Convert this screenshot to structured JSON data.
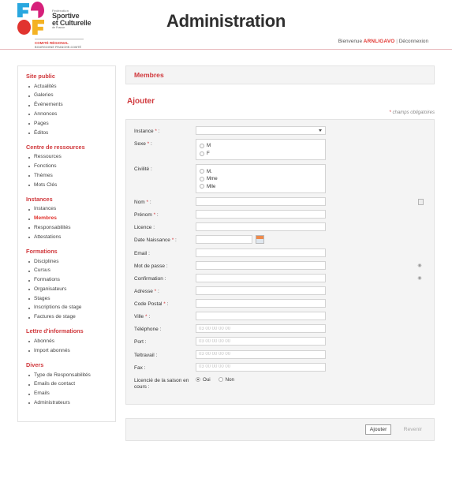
{
  "header": {
    "title": "Administration",
    "logo": {
      "federation": "Fédération",
      "line1": "Sportive",
      "line2": "et Culturelle",
      "line3": "de France",
      "comite": "COMITÉ RÉGIONAL",
      "region": "BOURGOGNE FRANCHE-COMTÉ"
    },
    "welcome_prefix": "Bienvenue",
    "username": "ARNLIGAVO",
    "separator": "|",
    "logout": "Déconnexion",
    "accent_color": "#d0383c"
  },
  "sidebar": {
    "groups": [
      {
        "title": "Site public",
        "items": [
          {
            "label": "Actualités",
            "active": false
          },
          {
            "label": "Galeries",
            "active": false
          },
          {
            "label": "Événements",
            "active": false
          },
          {
            "label": "Annonces",
            "active": false
          },
          {
            "label": "Pages",
            "active": false
          },
          {
            "label": "Éditos",
            "active": false
          }
        ]
      },
      {
        "title": "Centre de ressources",
        "items": [
          {
            "label": "Ressources",
            "active": false
          },
          {
            "label": "Fonctions",
            "active": false
          },
          {
            "label": "Thèmes",
            "active": false
          },
          {
            "label": "Mots Clés",
            "active": false
          }
        ]
      },
      {
        "title": "Instances",
        "items": [
          {
            "label": "Instances",
            "active": false
          },
          {
            "label": "Membres",
            "active": true
          },
          {
            "label": "Responsabilités",
            "active": false
          },
          {
            "label": "Attestations",
            "active": false
          }
        ]
      },
      {
        "title": "Formations",
        "items": [
          {
            "label": "Disciplines",
            "active": false
          },
          {
            "label": "Cursus",
            "active": false
          },
          {
            "label": "Formations",
            "active": false
          },
          {
            "label": "Organisateurs",
            "active": false
          },
          {
            "label": "Stages",
            "active": false
          },
          {
            "label": "Inscriptions de stage",
            "active": false
          },
          {
            "label": "Factures de stage",
            "active": false
          }
        ]
      },
      {
        "title": "Lettre d'informations",
        "items": [
          {
            "label": "Abonnés",
            "active": false
          },
          {
            "label": "Import abonnés",
            "active": false
          }
        ]
      },
      {
        "title": "Divers",
        "items": [
          {
            "label": "Type de Responsabilités",
            "active": false
          },
          {
            "label": "Emails de contact",
            "active": false
          },
          {
            "label": "Emails",
            "active": false
          },
          {
            "label": "Administrateurs",
            "active": false
          }
        ]
      }
    ]
  },
  "main": {
    "panel_title": "Membres",
    "section_title": "Ajouter",
    "required_star": "*",
    "required_note": " champs obligatoires",
    "fields": {
      "instance": {
        "label": "Instance",
        "required": true,
        "value": ""
      },
      "sexe": {
        "label": "Sexe",
        "required": true,
        "options": [
          {
            "label": "M",
            "selected": false
          },
          {
            "label": "F",
            "selected": false
          }
        ]
      },
      "civilite": {
        "label": "Civilité",
        "required": false,
        "options": [
          {
            "label": "M.",
            "selected": false
          },
          {
            "label": "Mme",
            "selected": false
          },
          {
            "label": "Mlle",
            "selected": false
          }
        ]
      },
      "nom": {
        "label": "Nom",
        "required": true,
        "value": "",
        "placeholder": ""
      },
      "prenom": {
        "label": "Prénom",
        "required": true,
        "value": "",
        "placeholder": ""
      },
      "licence": {
        "label": "Licence",
        "required": false,
        "value": "",
        "placeholder": ""
      },
      "date_naissance": {
        "label": "Date Naissance",
        "required": true,
        "value": "",
        "placeholder": ""
      },
      "email": {
        "label": "Email",
        "required": false,
        "value": "",
        "placeholder": ""
      },
      "mot_de_passe": {
        "label": "Mot de passe",
        "required": false,
        "value": "",
        "placeholder": ""
      },
      "confirmation": {
        "label": "Confirmation",
        "required": false,
        "value": "",
        "placeholder": ""
      },
      "adresse": {
        "label": "Adresse",
        "required": true,
        "value": "",
        "placeholder": ""
      },
      "code_postal": {
        "label": "Code Postal",
        "required": true,
        "value": "",
        "placeholder": ""
      },
      "ville": {
        "label": "Ville",
        "required": true,
        "value": "",
        "placeholder": ""
      },
      "telephone": {
        "label": "Téléphone",
        "required": false,
        "value": "",
        "placeholder": "03 00 00 00 00"
      },
      "port": {
        "label": "Port",
        "required": false,
        "value": "",
        "placeholder": "03 00 00 00 00"
      },
      "teltravail": {
        "label": "Teltravail",
        "required": false,
        "value": "",
        "placeholder": "03 00 00 00 00"
      },
      "fax": {
        "label": "Fax",
        "required": false,
        "value": "",
        "placeholder": "03 00 00 00 00"
      },
      "licencie_saison": {
        "label": "Licencié de la saison en cours",
        "required": false,
        "options": [
          {
            "label": "Oui",
            "selected": true
          },
          {
            "label": "Non",
            "selected": false
          }
        ]
      }
    },
    "buttons": {
      "submit": "Ajouter",
      "back": "Revenir"
    }
  }
}
